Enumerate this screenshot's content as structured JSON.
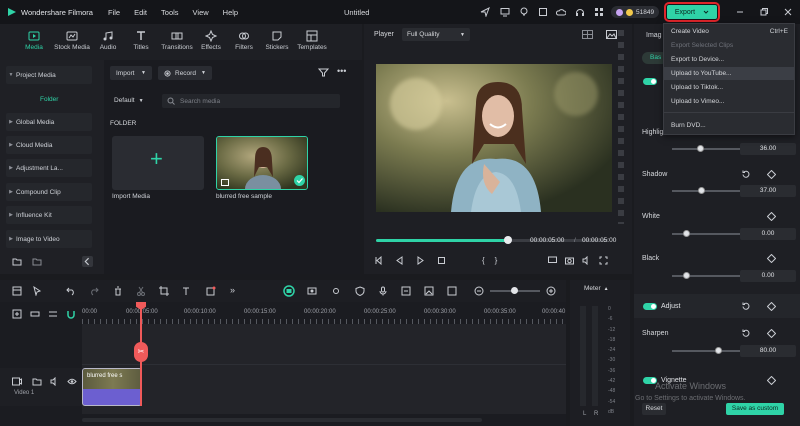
{
  "app": {
    "name": "Wondershare Filmora",
    "menu": [
      "File",
      "Edit",
      "Tools",
      "View",
      "Help"
    ],
    "doc_title": "Untitled",
    "credits": "51849",
    "export_label": "Export"
  },
  "export_menu": {
    "items": [
      {
        "label": "Create Video",
        "shortcut": "Ctrl+E",
        "state": "normal"
      },
      {
        "label": "Export Selected Clips",
        "shortcut": "",
        "state": "disabled"
      },
      {
        "label": "Export to Device...",
        "shortcut": "",
        "state": "normal"
      },
      {
        "label": "Upload to YouTube...",
        "shortcut": "",
        "state": "highlighted"
      },
      {
        "label": "Upload to Tiktok...",
        "shortcut": "",
        "state": "normal"
      },
      {
        "label": "Upload to Vimeo...",
        "shortcut": "",
        "state": "normal"
      },
      {
        "label": "Burn DVD...",
        "shortcut": "",
        "state": "normal"
      }
    ]
  },
  "toolbar_tabs": [
    {
      "label": "Media",
      "icon": "media-icon",
      "active": true
    },
    {
      "label": "Stock Media",
      "icon": "stock-media-icon",
      "active": false
    },
    {
      "label": "Audio",
      "icon": "audio-icon",
      "active": false
    },
    {
      "label": "Titles",
      "icon": "titles-icon",
      "active": false
    },
    {
      "label": "Transitions",
      "icon": "transitions-icon",
      "active": false
    },
    {
      "label": "Effects",
      "icon": "effects-icon",
      "active": false
    },
    {
      "label": "Filters",
      "icon": "filters-icon",
      "active": false
    },
    {
      "label": "Stickers",
      "icon": "stickers-icon",
      "active": false
    },
    {
      "label": "Templates",
      "icon": "templates-icon",
      "active": false
    }
  ],
  "left_panel": {
    "items": [
      "Project Media",
      "Folder",
      "Global Media",
      "Cloud Media",
      "Adjustment La...",
      "Compound Clip",
      "Influence Kit",
      "Image to Video"
    ]
  },
  "media": {
    "import_label": "Import",
    "record_label": "Record",
    "sort_label": "Default",
    "search_placeholder": "Search media",
    "section_title": "FOLDER",
    "cards": [
      {
        "label": "Import Media"
      },
      {
        "label": "blurred free sample"
      }
    ]
  },
  "player": {
    "label": "Player",
    "quality": "Full Quality",
    "current_time": "00:00:05:00",
    "total_time": "00:00:05:00",
    "progress": 1.0
  },
  "timeline": {
    "ruler": [
      "00:00",
      "00:00:05:00",
      "00:00:10:00",
      "00:00:15:00",
      "00:00:20:00",
      "00:00:25:00",
      "00:00:30:00",
      "00:00:35:00",
      "00:00:40"
    ],
    "clip_label": "blurred free s",
    "track_label": "Video 1",
    "meter_label": "Meter",
    "meter_scale": [
      "0",
      "-6",
      "-12",
      "-18",
      "-24",
      "-30",
      "-36",
      "-42",
      "-48",
      "-54",
      "dB"
    ],
    "meter_lr": [
      "L",
      "R"
    ]
  },
  "right_panel": {
    "tab_partial": "Imag",
    "subtab_partial": "Bas",
    "rows": [
      {
        "label": "Highlig",
        "value": "36.00",
        "level": 0.72
      },
      {
        "label": "Shadow",
        "value": "37.00",
        "level": 0.73
      },
      {
        "label": "White",
        "value": "0.00",
        "level": 0.5
      },
      {
        "label": "Black",
        "value": "0.00",
        "level": 0.5
      }
    ],
    "adjust_label": "Adjust",
    "sharpen": {
      "label": "Sharpen",
      "value": "80.00",
      "level": 0.9
    },
    "vignette_label": "Vignette",
    "reset_label": "Reset",
    "save_custom_label": "Save as custom"
  },
  "watermark": {
    "line1": "Activate Windows",
    "line2": "Go to Settings to activate Windows."
  }
}
